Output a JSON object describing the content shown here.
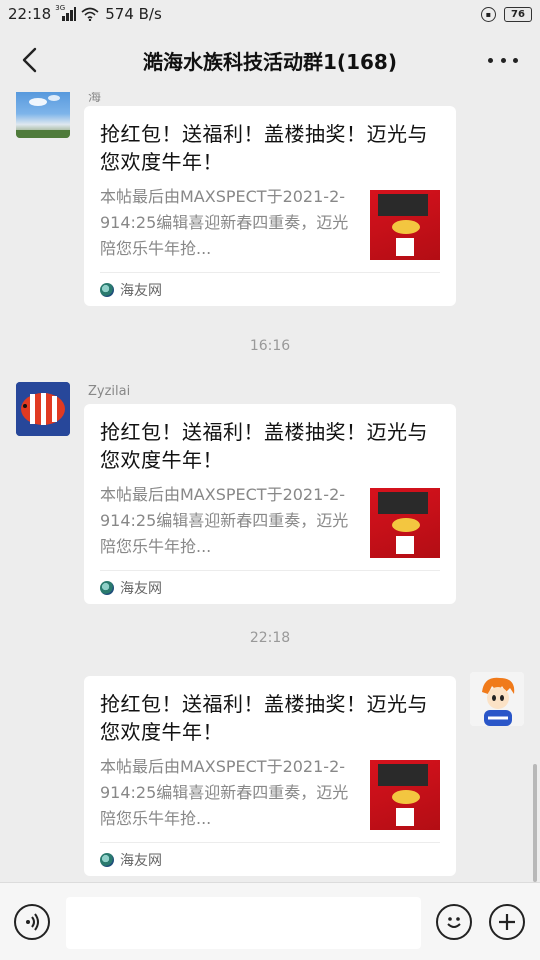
{
  "status": {
    "time": "22:18",
    "network_type": "3G",
    "net_speed": "574 B/s",
    "battery": "76"
  },
  "header": {
    "title": "澔海水族科技活动群1(168)"
  },
  "messages": [
    {
      "sender": "海",
      "title": "抢红包！送福利！盖楼抽奖！迈光与您欢度牛年！",
      "desc": "本帖最后由MAXSPECT于2021-2-914:25编辑喜迎新春四重奏，迈光陪您乐牛年抢...",
      "source": "海友网"
    },
    {
      "sender": "Zyzilai",
      "title": "抢红包！送福利！盖楼抽奖！迈光与您欢度牛年！",
      "desc": "本帖最后由MAXSPECT于2021-2-914:25编辑喜迎新春四重奏，迈光陪您乐牛年抢...",
      "source": "海友网"
    },
    {
      "sender": "",
      "title": "抢红包！送福利！盖楼抽奖！迈光与您欢度牛年！",
      "desc": "本帖最后由MAXSPECT于2021-2-914:25编辑喜迎新春四重奏，迈光陪您乐牛年抢...",
      "source": "海友网"
    }
  ],
  "timestamps": [
    "16:16",
    "22:18"
  ],
  "icons": {
    "back": "chevron-left-icon",
    "more": "more-dots-icon",
    "voice": "voice-icon",
    "emoji": "emoji-icon",
    "plus": "plus-icon"
  }
}
